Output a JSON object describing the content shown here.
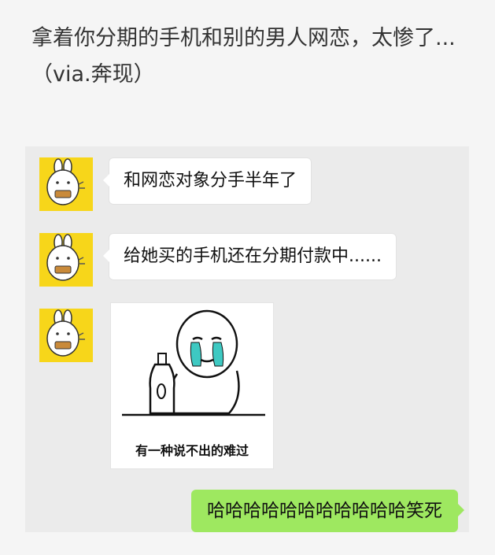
{
  "post": {
    "caption": "拿着你分期的手机和别的男人网恋，太惨了...（via.奔现）"
  },
  "chat": {
    "messages": [
      {
        "sender": "friend",
        "avatar_icon": "bunny-avatar-icon",
        "text": "和网恋对象分手半年了"
      },
      {
        "sender": "friend",
        "avatar_icon": "bunny-avatar-icon",
        "text": "给她买的手机还在分期付款中......"
      },
      {
        "sender": "friend",
        "avatar_icon": "bunny-avatar-icon",
        "sticker_caption": "有一种说不出的难过",
        "sticker_icon": "crying-meme-face-bottle-icon"
      },
      {
        "sender": "me",
        "text": "哈哈哈哈哈哈哈哈哈哈哈笑死"
      }
    ]
  },
  "colors": {
    "page_background": "#f5f5f5",
    "chat_background": "#ebebeb",
    "friend_bubble": "#ffffff",
    "my_bubble": "#9ee860",
    "avatar_background": "#f7d61a",
    "tear_color": "#3ec9c2"
  }
}
